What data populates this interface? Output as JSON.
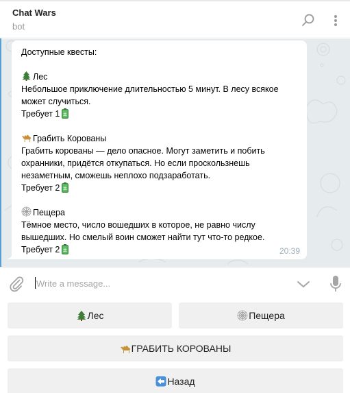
{
  "header": {
    "title": "Chat Wars",
    "subtitle": "bot",
    "search_icon": "search-icon",
    "more_icon": "more-vertical-icon"
  },
  "message": {
    "intro": "Доступные квесты:",
    "quests": [
      {
        "icon": "evergreen-tree",
        "title": "Лес",
        "description": "Небольшое приключение длительностью 5 минут. В лесу всякое может случиться.",
        "requires_label": "Требует 1",
        "requires_icon": "battery"
      },
      {
        "icon": "camel",
        "title": "Грабить Корованы",
        "description": "Грабить корованы — дело опасное. Могут заметить и побить охранники, придётся откупаться. Но если проскользнешь незаметным, сможешь неплохо подзаработать.",
        "requires_label": "Требует 2",
        "requires_icon": "battery"
      },
      {
        "icon": "spider-web",
        "title": "Пещера",
        "description": "Тёмное место, число вошедших в которое, не равно числу вышедших. Но смелый воин сможет найти тут что-то редкое.",
        "requires_label": "Требует 2",
        "requires_icon": "battery"
      }
    ],
    "time": "20:39"
  },
  "composer": {
    "placeholder": "Write a message...",
    "value": ""
  },
  "keyboard": {
    "buttons": [
      {
        "icon": "evergreen-tree",
        "label": "Лес"
      },
      {
        "icon": "spider-web",
        "label": "Пещера"
      },
      {
        "icon": "camel",
        "label": "ГРАБИТЬ КОРОВАНЫ"
      },
      {
        "icon": "left-arrow-box",
        "label": "Назад"
      }
    ]
  },
  "colors": {
    "chat_background": "#e6ebee",
    "keyboard_button": "#f0f0f0",
    "accent": "#5a9fd4",
    "battery_green": "#4caf50"
  }
}
